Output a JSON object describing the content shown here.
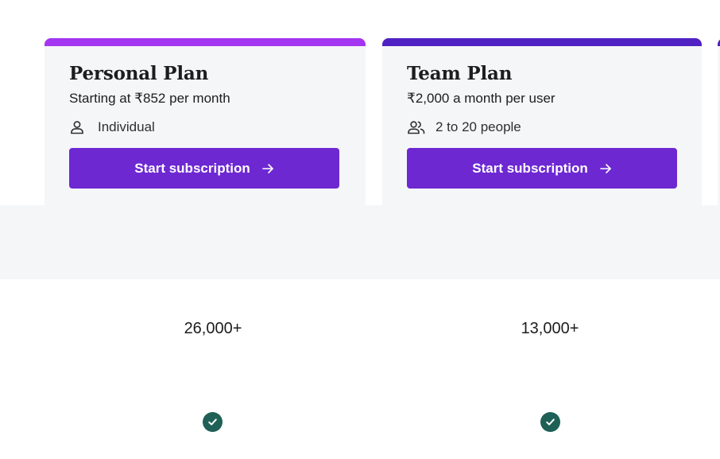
{
  "colors": {
    "personal_accent": "#a435f0",
    "team_accent": "#5022c3",
    "button_bg": "#6d28d2",
    "button_text": "#ffffff",
    "card_bg": "#f5f6f8",
    "check_bg": "#1e6055"
  },
  "plans": [
    {
      "title": "Personal Plan",
      "price": "Starting at ₹852 per month",
      "seats": "Individual",
      "seat_icon": "person-icon",
      "cta": "Start subscription",
      "cta_icon": "arrow-right-icon",
      "stat": "26,000+",
      "included_icon": "check-circle-icon"
    },
    {
      "title": "Team Plan",
      "price": "₹2,000 a month per user",
      "seats": "2 to 20 people",
      "seat_icon": "people-icon",
      "cta": "Start subscription",
      "cta_icon": "arrow-right-icon",
      "stat": "13,000+",
      "included_icon": "check-circle-icon"
    }
  ]
}
